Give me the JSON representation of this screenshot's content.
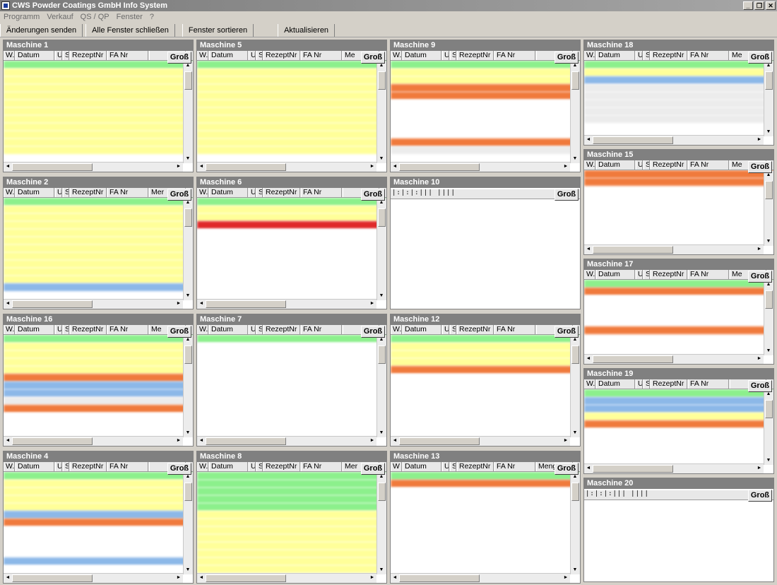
{
  "window": {
    "title": "CWS Powder Coatings GmbH Info System"
  },
  "menu": [
    "Programm",
    "Verkauf",
    "QS / QP",
    "Fenster",
    "?"
  ],
  "toolbar": [
    "Änderungen senden",
    "Alle Fenster schließen",
    "Fenster sortieren",
    "Aktualisieren"
  ],
  "gross_label": "Groß",
  "empty_ticks": "|:|:|:|||  ||||",
  "panels": [
    {
      "title": "Maschine 1",
      "rows": [
        "green",
        "yellow",
        "yellow",
        "yellow",
        "yellow",
        "yellow",
        "yellow",
        "yellow",
        "yellow",
        "yellow",
        "yellow",
        "yellow"
      ],
      "columns": [
        "W.",
        "Datum",
        "U.",
        "S",
        "RezeptNr",
        "FA Nr",
        ""
      ]
    },
    {
      "title": "Maschine 5",
      "rows": [
        "green",
        "yellow",
        "yellow",
        "yellow",
        "yellow",
        "yellow",
        "yellow",
        "yellow",
        "yellow",
        "yellow",
        "yellow",
        "yellow"
      ],
      "columns": [
        "W.",
        "Datum",
        "U",
        "S",
        "RezeptNr",
        "FA Nr",
        "Me"
      ]
    },
    {
      "title": "Maschine 9",
      "rows": [
        "green",
        "yellow",
        "yellow",
        "orange",
        "orange",
        "white",
        "white",
        "white",
        "white",
        "white",
        "orange",
        "grey"
      ],
      "columns": [
        "W.",
        "Datum",
        "U",
        "S",
        "RezeptNr",
        "FA Nr",
        ""
      ]
    },
    {
      "title": "Maschine 18",
      "rows": [
        "green",
        "yellow",
        "blue",
        "grey",
        "grey",
        "grey",
        "grey",
        "grey"
      ],
      "columns": [
        "W.",
        "Datum",
        "U",
        "S",
        "RezeptNr",
        "FA Nr",
        "Me"
      ]
    },
    {
      "title": "Maschine 2",
      "rows": [
        "green",
        "yellow",
        "yellow",
        "yellow",
        "yellow",
        "yellow",
        "yellow",
        "yellow",
        "yellow",
        "yellow",
        "yellow",
        "blue"
      ],
      "columns": [
        "W.",
        "Datum",
        "U",
        "S",
        "RezeptNr",
        "FA Nr",
        "Mer"
      ]
    },
    {
      "title": "Maschine 6",
      "rows": [
        "green",
        "yellow",
        "yellow",
        "red",
        "white",
        "white",
        "white",
        "white",
        "white",
        "white",
        "white",
        "white"
      ],
      "columns": [
        "W.",
        "Datum",
        "U",
        "S",
        "RezeptNr",
        "FA Nr",
        ""
      ]
    },
    {
      "title": "Maschine 10",
      "rows": [],
      "columns": []
    },
    {
      "title": "Maschine 15",
      "rows": [
        "orange",
        "orange"
      ],
      "columns": [
        "W.",
        "Datum",
        "U",
        "S",
        "RezeptNr",
        "FA Nr",
        "Me"
      ]
    },
    {
      "title": "Maschine 17",
      "rows": [
        "green",
        "orange",
        "white",
        "white",
        "white",
        "white",
        "orange"
      ],
      "columns": [
        "W.",
        "Datum",
        "U",
        "S",
        "RezeptNr",
        "FA Nr",
        "Me"
      ]
    },
    {
      "title": "Maschine 16",
      "rows": [
        "green",
        "yellow",
        "yellow",
        "yellow",
        "yellow",
        "orange",
        "blue",
        "blue",
        "grey",
        "orange",
        "white",
        "white"
      ],
      "columns": [
        "W.",
        "Datum",
        "U",
        "S",
        "RezeptNr",
        "FA Nr",
        "Me"
      ]
    },
    {
      "title": "Maschine 7",
      "rows": [
        "green",
        "white",
        "white",
        "white",
        "white",
        "white",
        "white",
        "white",
        "white",
        "white",
        "white",
        "white"
      ],
      "columns": [
        "W.",
        "Datum",
        "U",
        "S",
        "RezeptNr",
        "FA Nr",
        ""
      ]
    },
    {
      "title": "Maschine 12",
      "rows": [
        "green",
        "yellow",
        "yellow",
        "yellow",
        "orange",
        "white",
        "white",
        "white",
        "white",
        "white",
        "white",
        "white"
      ],
      "columns": [
        "W.",
        "Datum",
        "U",
        "S",
        "RezeptNr",
        "FA Nr",
        ""
      ]
    },
    {
      "title": "Maschine 19",
      "rows": [
        "green",
        "blue",
        "blue",
        "yellow",
        "orange",
        "white",
        "white",
        "white",
        "white",
        "white"
      ],
      "columns": [
        "W.",
        "Datum",
        "U",
        "S",
        "RezeptNr",
        "FA Nr",
        ""
      ]
    },
    {
      "title": "Maschine 20",
      "rows": [],
      "columns": []
    },
    {
      "title": "Maschine 4",
      "rows": [
        "green",
        "yellow",
        "yellow",
        "yellow",
        "yellow",
        "blue",
        "orange",
        "white",
        "white",
        "white",
        "white",
        "blue",
        "white"
      ],
      "columns": [
        "W.",
        "Datum",
        "U",
        "S",
        "RezeptNr",
        "FA Nr",
        ""
      ]
    },
    {
      "title": "Maschine 8",
      "rows": [
        "green",
        "green",
        "green",
        "green",
        "green",
        "yellow",
        "yellow",
        "yellow",
        "yellow",
        "yellow",
        "yellow",
        "yellow",
        "yellow"
      ],
      "columns": [
        "W.",
        "Datum",
        "U",
        "S",
        "RezeptNr",
        "FA Nr",
        "Mer"
      ]
    },
    {
      "title": "Maschine 13",
      "rows": [
        "green",
        "orange",
        "white",
        "white",
        "white",
        "white",
        "white",
        "white"
      ],
      "columns": [
        "W",
        "Datum",
        "U",
        "S",
        "RezeptNr",
        "FA Nr",
        "Menge"
      ]
    }
  ]
}
